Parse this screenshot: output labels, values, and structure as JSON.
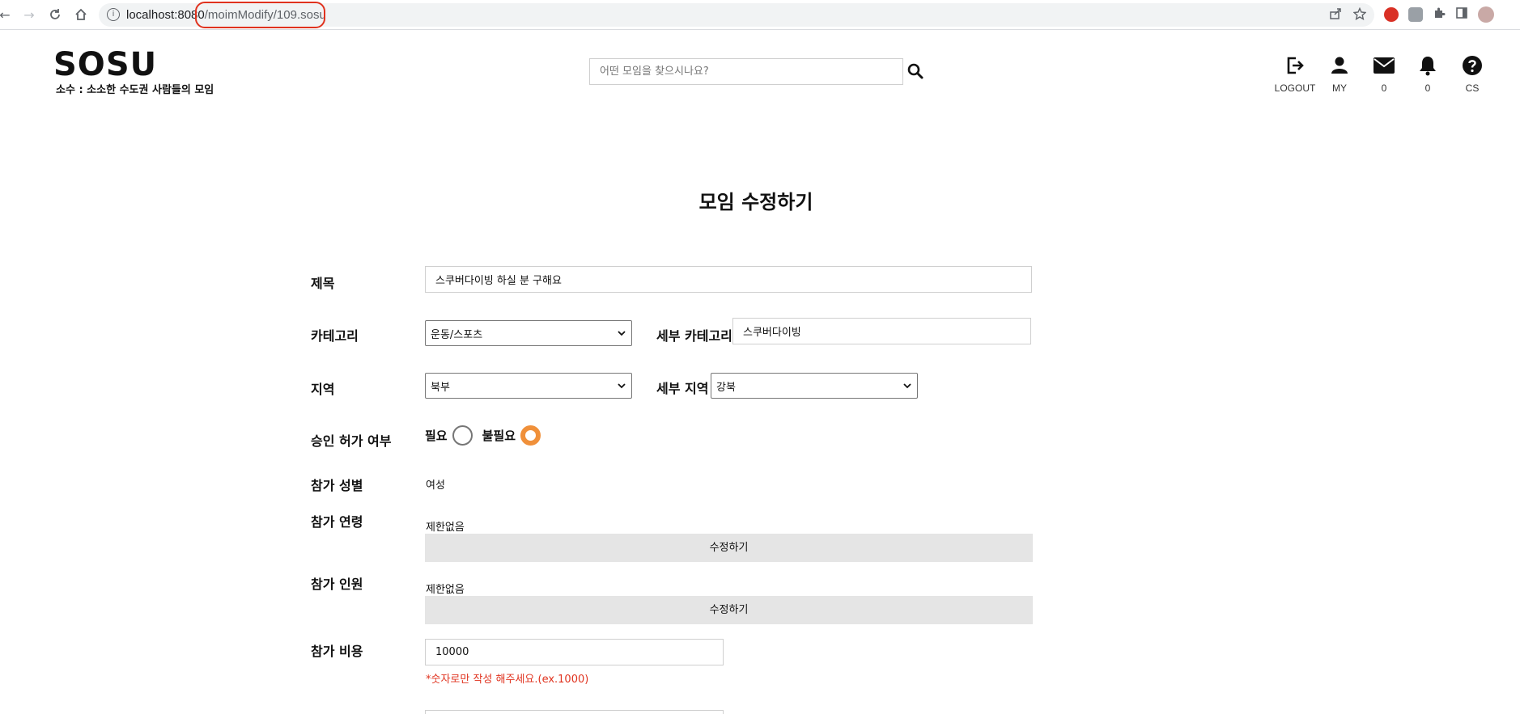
{
  "browser": {
    "url_host": "localhost:8080",
    "url_path": "/moimModify/109.sosu"
  },
  "site": {
    "logo": "SOSU",
    "tagline": "소수 : 소소한 수도권 사람들의 모임",
    "search_placeholder": "어떤 모임을 찾으시나요?"
  },
  "header_icons": [
    {
      "icon": "logout-icon",
      "label": "LOGOUT"
    },
    {
      "icon": "user-icon",
      "label": "MY"
    },
    {
      "icon": "mail-icon",
      "label": "0"
    },
    {
      "icon": "bell-icon",
      "label": "0"
    },
    {
      "icon": "help-icon",
      "label": "CS"
    }
  ],
  "form": {
    "page_title": "모임 수정하기",
    "title_label": "제목",
    "title_value": "스쿠버다이빙 하실 분 구해요",
    "category_label": "카테고리",
    "category_value": "운동/스포츠",
    "subcategory_label": "세부 카테고리",
    "subcategory_value": "스쿠버다이빙",
    "region_label": "지역",
    "region_value": "북부",
    "subregion_label": "세부 지역",
    "subregion_value": "강북",
    "approval_label": "승인 허가 여부",
    "approval_required": "필요",
    "approval_not_required": "불필요",
    "approval_selected": "불필요",
    "gender_label": "참가 성별",
    "gender_value": "여성",
    "age_label": "참가 연령",
    "age_value": "제한없음",
    "age_button": "수정하기",
    "headcount_label": "참가 인원",
    "headcount_value": "제한없음",
    "headcount_button": "수정하기",
    "fee_label": "참가 비용",
    "fee_value": "10000",
    "fee_hint": "*숫자로만 작성 해주세요.(ex.1000)"
  },
  "colors": {
    "accent": "#f0903a",
    "hint": "#e0321e",
    "url_highlight": "#e0321e"
  }
}
